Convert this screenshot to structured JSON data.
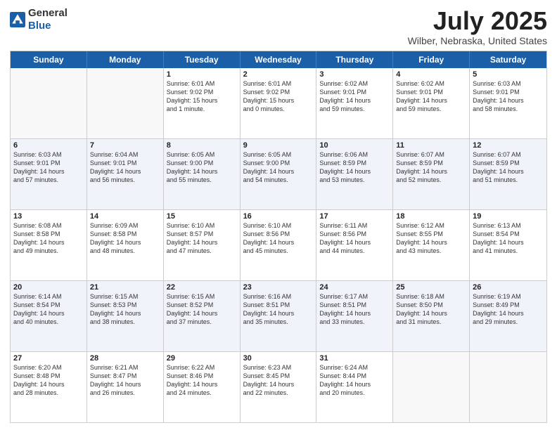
{
  "header": {
    "logo_general": "General",
    "logo_blue": "Blue",
    "title": "July 2025",
    "location": "Wilber, Nebraska, United States"
  },
  "calendar": {
    "days": [
      "Sunday",
      "Monday",
      "Tuesday",
      "Wednesday",
      "Thursday",
      "Friday",
      "Saturday"
    ],
    "rows": [
      [
        {
          "day": "",
          "text": ""
        },
        {
          "day": "",
          "text": ""
        },
        {
          "day": "1",
          "text": "Sunrise: 6:01 AM\nSunset: 9:02 PM\nDaylight: 15 hours\nand 1 minute."
        },
        {
          "day": "2",
          "text": "Sunrise: 6:01 AM\nSunset: 9:02 PM\nDaylight: 15 hours\nand 0 minutes."
        },
        {
          "day": "3",
          "text": "Sunrise: 6:02 AM\nSunset: 9:01 PM\nDaylight: 14 hours\nand 59 minutes."
        },
        {
          "day": "4",
          "text": "Sunrise: 6:02 AM\nSunset: 9:01 PM\nDaylight: 14 hours\nand 59 minutes."
        },
        {
          "day": "5",
          "text": "Sunrise: 6:03 AM\nSunset: 9:01 PM\nDaylight: 14 hours\nand 58 minutes."
        }
      ],
      [
        {
          "day": "6",
          "text": "Sunrise: 6:03 AM\nSunset: 9:01 PM\nDaylight: 14 hours\nand 57 minutes."
        },
        {
          "day": "7",
          "text": "Sunrise: 6:04 AM\nSunset: 9:01 PM\nDaylight: 14 hours\nand 56 minutes."
        },
        {
          "day": "8",
          "text": "Sunrise: 6:05 AM\nSunset: 9:00 PM\nDaylight: 14 hours\nand 55 minutes."
        },
        {
          "day": "9",
          "text": "Sunrise: 6:05 AM\nSunset: 9:00 PM\nDaylight: 14 hours\nand 54 minutes."
        },
        {
          "day": "10",
          "text": "Sunrise: 6:06 AM\nSunset: 8:59 PM\nDaylight: 14 hours\nand 53 minutes."
        },
        {
          "day": "11",
          "text": "Sunrise: 6:07 AM\nSunset: 8:59 PM\nDaylight: 14 hours\nand 52 minutes."
        },
        {
          "day": "12",
          "text": "Sunrise: 6:07 AM\nSunset: 8:59 PM\nDaylight: 14 hours\nand 51 minutes."
        }
      ],
      [
        {
          "day": "13",
          "text": "Sunrise: 6:08 AM\nSunset: 8:58 PM\nDaylight: 14 hours\nand 49 minutes."
        },
        {
          "day": "14",
          "text": "Sunrise: 6:09 AM\nSunset: 8:58 PM\nDaylight: 14 hours\nand 48 minutes."
        },
        {
          "day": "15",
          "text": "Sunrise: 6:10 AM\nSunset: 8:57 PM\nDaylight: 14 hours\nand 47 minutes."
        },
        {
          "day": "16",
          "text": "Sunrise: 6:10 AM\nSunset: 8:56 PM\nDaylight: 14 hours\nand 45 minutes."
        },
        {
          "day": "17",
          "text": "Sunrise: 6:11 AM\nSunset: 8:56 PM\nDaylight: 14 hours\nand 44 minutes."
        },
        {
          "day": "18",
          "text": "Sunrise: 6:12 AM\nSunset: 8:55 PM\nDaylight: 14 hours\nand 43 minutes."
        },
        {
          "day": "19",
          "text": "Sunrise: 6:13 AM\nSunset: 8:54 PM\nDaylight: 14 hours\nand 41 minutes."
        }
      ],
      [
        {
          "day": "20",
          "text": "Sunrise: 6:14 AM\nSunset: 8:54 PM\nDaylight: 14 hours\nand 40 minutes."
        },
        {
          "day": "21",
          "text": "Sunrise: 6:15 AM\nSunset: 8:53 PM\nDaylight: 14 hours\nand 38 minutes."
        },
        {
          "day": "22",
          "text": "Sunrise: 6:15 AM\nSunset: 8:52 PM\nDaylight: 14 hours\nand 37 minutes."
        },
        {
          "day": "23",
          "text": "Sunrise: 6:16 AM\nSunset: 8:51 PM\nDaylight: 14 hours\nand 35 minutes."
        },
        {
          "day": "24",
          "text": "Sunrise: 6:17 AM\nSunset: 8:51 PM\nDaylight: 14 hours\nand 33 minutes."
        },
        {
          "day": "25",
          "text": "Sunrise: 6:18 AM\nSunset: 8:50 PM\nDaylight: 14 hours\nand 31 minutes."
        },
        {
          "day": "26",
          "text": "Sunrise: 6:19 AM\nSunset: 8:49 PM\nDaylight: 14 hours\nand 29 minutes."
        }
      ],
      [
        {
          "day": "27",
          "text": "Sunrise: 6:20 AM\nSunset: 8:48 PM\nDaylight: 14 hours\nand 28 minutes."
        },
        {
          "day": "28",
          "text": "Sunrise: 6:21 AM\nSunset: 8:47 PM\nDaylight: 14 hours\nand 26 minutes."
        },
        {
          "day": "29",
          "text": "Sunrise: 6:22 AM\nSunset: 8:46 PM\nDaylight: 14 hours\nand 24 minutes."
        },
        {
          "day": "30",
          "text": "Sunrise: 6:23 AM\nSunset: 8:45 PM\nDaylight: 14 hours\nand 22 minutes."
        },
        {
          "day": "31",
          "text": "Sunrise: 6:24 AM\nSunset: 8:44 PM\nDaylight: 14 hours\nand 20 minutes."
        },
        {
          "day": "",
          "text": ""
        },
        {
          "day": "",
          "text": ""
        }
      ]
    ]
  }
}
